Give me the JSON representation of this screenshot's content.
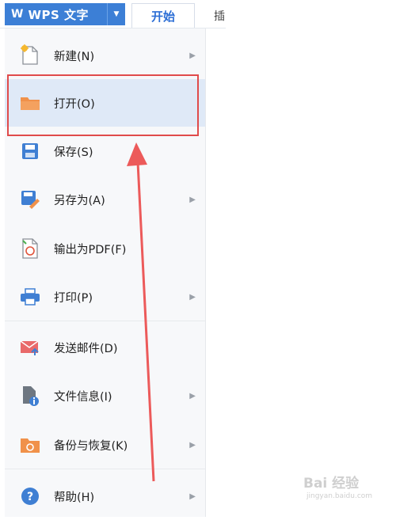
{
  "app": {
    "logo_glyph": "W",
    "title": "WPS 文字",
    "dropdown_glyph": "▼",
    "accent_color": "#3c7fd6"
  },
  "tabs": [
    {
      "label": "开始"
    },
    {
      "label": "插"
    }
  ],
  "menu": {
    "items": [
      {
        "label": "新建(N)",
        "icon": "new-document-icon",
        "has_submenu": true
      },
      {
        "label": "打开(O)",
        "icon": "open-folder-icon",
        "has_submenu": false,
        "selected": true
      },
      {
        "label": "保存(S)",
        "icon": "save-disk-icon",
        "has_submenu": false
      },
      {
        "label": "另存为(A)",
        "icon": "save-as-icon",
        "has_submenu": true
      },
      {
        "label": "输出为PDF(F)",
        "icon": "export-pdf-icon",
        "has_submenu": false
      },
      {
        "label": "打印(P)",
        "icon": "printer-icon",
        "has_submenu": true
      },
      {
        "label": "发送邮件(D)",
        "icon": "send-mail-icon",
        "has_submenu": false
      },
      {
        "label": "文件信息(I)",
        "icon": "file-info-icon",
        "has_submenu": true
      },
      {
        "label": "备份与恢复(K)",
        "icon": "backup-restore-icon",
        "has_submenu": true
      },
      {
        "label": "帮助(H)",
        "icon": "help-icon",
        "has_submenu": true
      }
    ],
    "submenu_glyph": "▶"
  },
  "annotation": {
    "highlight_color": "#e04b4b"
  },
  "watermark": {
    "main": "Bai 经验",
    "sub": "jingyan.baidu.com"
  }
}
